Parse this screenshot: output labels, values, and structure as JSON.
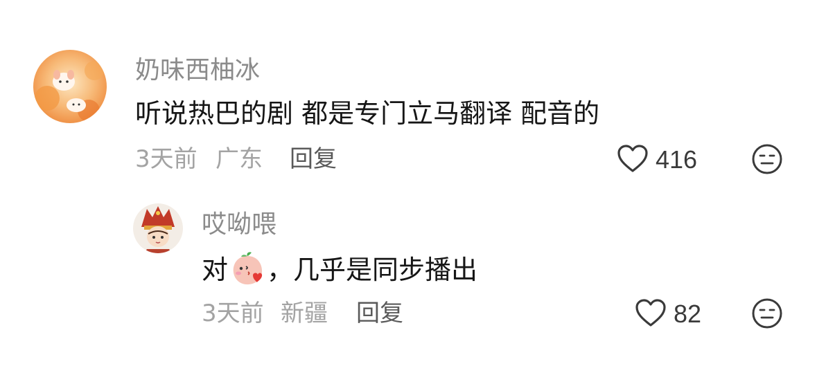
{
  "comments": [
    {
      "username": "奶味西柚冰",
      "text": "听说热巴的剧 都是专门立马翻译 配音的",
      "time": "3天前",
      "location": "广东",
      "reply_label": "回复",
      "likes": "416"
    },
    {
      "username": "哎呦喂",
      "text_before": "对",
      "text_after": "，几乎是同步播出",
      "time": "3天前",
      "location": "新疆",
      "reply_label": "回复",
      "likes": "82"
    }
  ],
  "icons": {
    "like": "heart-outline-icon",
    "react": "meh-face-icon",
    "inline_emoji": "kiss-peach-emoji-icon"
  },
  "colors": {
    "username": "#8b8b8b",
    "text": "#161616",
    "meta": "#a3a3a3",
    "reply": "#5a5a5a",
    "icon": "#3a3a3a"
  }
}
